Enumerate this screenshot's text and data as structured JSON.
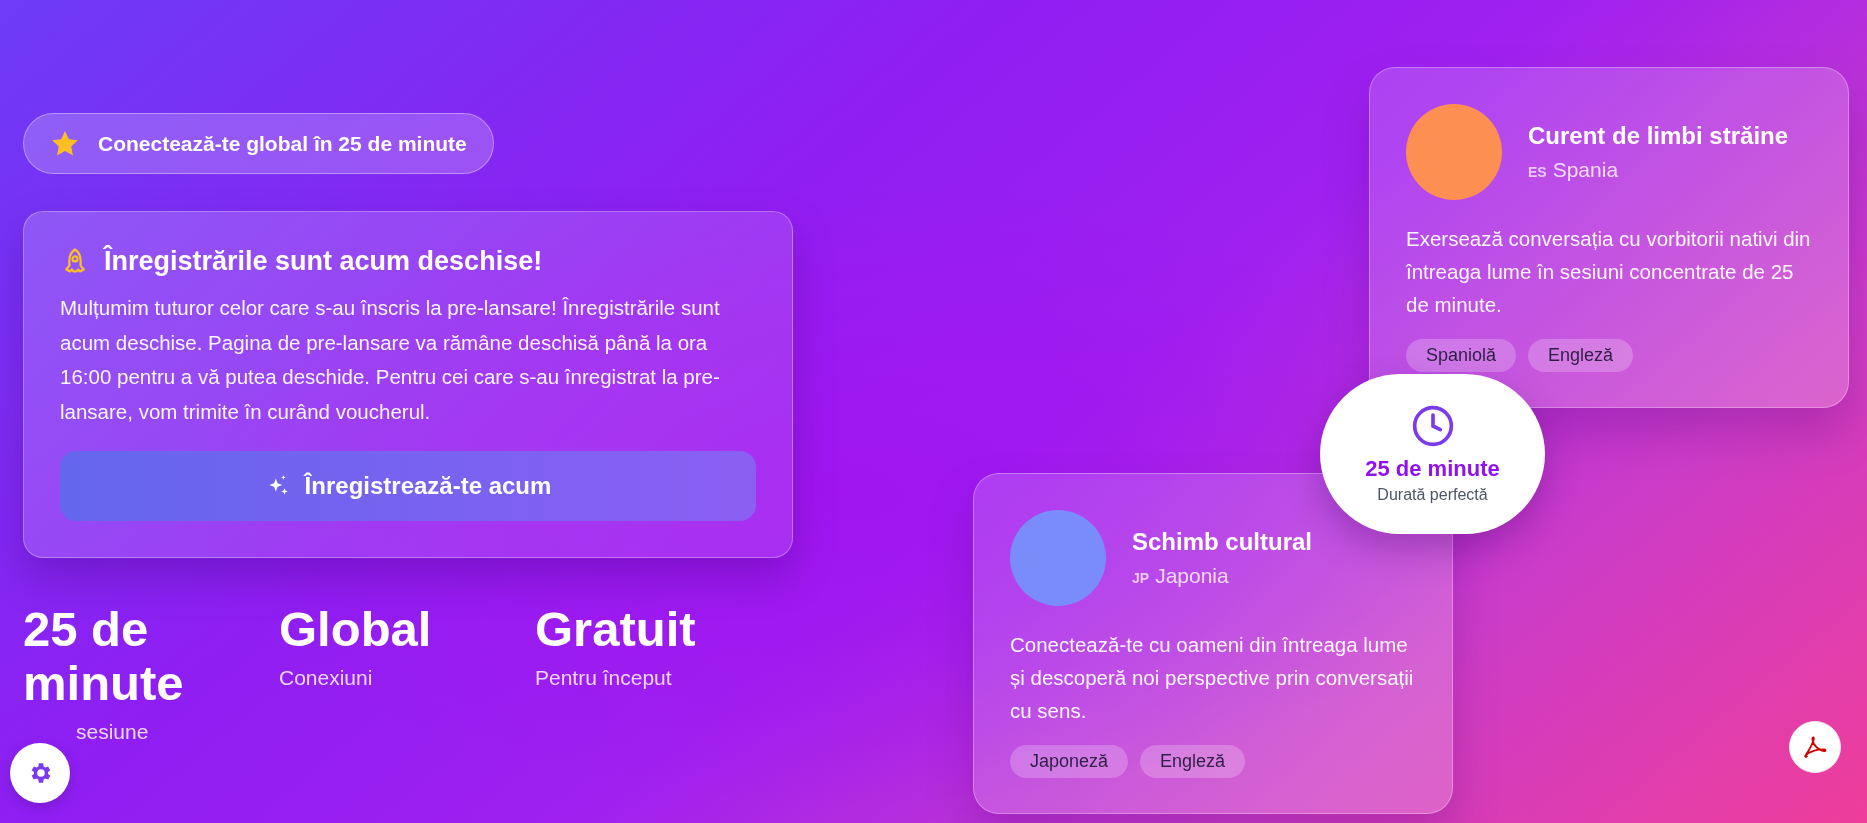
{
  "badge": {
    "text": "Conectează-te global în 25 de minute"
  },
  "announcement": {
    "title": "Înregistrările sunt acum deschise!",
    "body": "Mulțumim tuturor celor care s-au înscris la pre-lansare! Înregistrările sunt acum deschise. Pagina de pre-lansare va rămâne deschisă până la ora 16:00 pentru a vă putea deschide. Pentru cei care s-au înregistrat la pre-lansare, vom trimite în curând voucherul.",
    "button": "Înregistrează-te acum"
  },
  "stats": [
    {
      "value": "25 de minute",
      "label": "sesiune"
    },
    {
      "value": "Global",
      "label": "Conexiuni"
    },
    {
      "value": "Gratuit",
      "label": "Pentru început"
    }
  ],
  "cards": [
    {
      "title": "Curent de limbi străine",
      "country_code": "ES",
      "country": "Spania",
      "color": "#fd8f52",
      "description": "Exersează conversația cu vorbitorii nativi din întreaga lume în sesiuni concentrate de 25 de minute.",
      "tags": [
        "Spaniolă",
        "Engleză"
      ]
    },
    {
      "title": "Schimb cultural",
      "country_code": "JP",
      "country": "Japonia",
      "color": "#7a8cf9",
      "description": "Conectează-te cu oameni din întreaga lume și descoperă noi perspective prin conversații cu sens.",
      "tags": [
        "Japoneză",
        "Engleză"
      ]
    }
  ],
  "duration_bubble": {
    "value": "25 de minute",
    "label": "Durată perfectă"
  }
}
